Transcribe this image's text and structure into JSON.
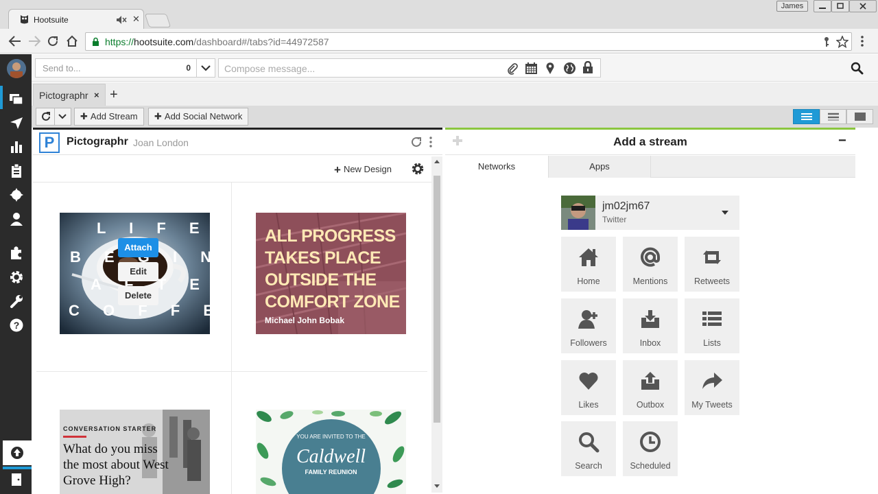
{
  "browser": {
    "tab_title": "Hootsuite",
    "user_badge": "James",
    "url_scheme": "https://",
    "url_host": "hootsuite.com",
    "url_path": "/dashboard#/tabs?id=44972587"
  },
  "compose": {
    "send_to_placeholder": "Send to...",
    "send_to_count": "0",
    "message_placeholder": "Compose message..."
  },
  "tabs": {
    "active_tab": "Pictographr",
    "close_glyph": "×",
    "add_glyph": "+"
  },
  "toolbar": {
    "add_stream": "Add Stream",
    "add_social_network": "Add Social Network"
  },
  "stream": {
    "title": "Pictographr",
    "subtitle": "Joan London",
    "new_design": "New Design",
    "card1": {
      "words": [
        "L I F E",
        "B E G I N S",
        "A F T E R",
        "C O F F E E"
      ],
      "attach": "Attach",
      "edit": "Edit",
      "delete": "Delete"
    },
    "card2": {
      "quote": "ALL PROGRESS TAKES PLACE OUTSIDE THE COMFORT ZONE",
      "author": "Michael John Bobak"
    },
    "card3": {
      "eyebrow": "CONVERSATION STARTER",
      "question": "What do you miss the most about West Grove High?"
    },
    "card4": {
      "invite": "YOU ARE INVITED TO THE",
      "name": "Caldwell",
      "family": "FAMILY REUNION"
    }
  },
  "add_stream": {
    "title": "Add a stream",
    "collapse_glyph": "−",
    "tabs": [
      "Networks",
      "Apps"
    ],
    "account": {
      "username": "jm02jm67",
      "network": "Twitter"
    },
    "tiles": [
      {
        "label": "Home",
        "icon": "home-icon"
      },
      {
        "label": "Mentions",
        "icon": "at-icon"
      },
      {
        "label": "Retweets",
        "icon": "retweet-icon"
      },
      {
        "label": "Followers",
        "icon": "add-user-icon"
      },
      {
        "label": "Inbox",
        "icon": "inbox-icon"
      },
      {
        "label": "Lists",
        "icon": "list-icon"
      },
      {
        "label": "Likes",
        "icon": "heart-icon"
      },
      {
        "label": "Outbox",
        "icon": "outbox-icon"
      },
      {
        "label": "My Tweets",
        "icon": "share-arrow-icon"
      },
      {
        "label": "Search",
        "icon": "search-icon"
      },
      {
        "label": "Scheduled",
        "icon": "clock-icon"
      }
    ]
  },
  "colors": {
    "accent_blue": "#1f9ad6",
    "attach_blue": "#1d8fe6",
    "green_border": "#8bc63f",
    "nav_bg": "#2b2b2b"
  }
}
